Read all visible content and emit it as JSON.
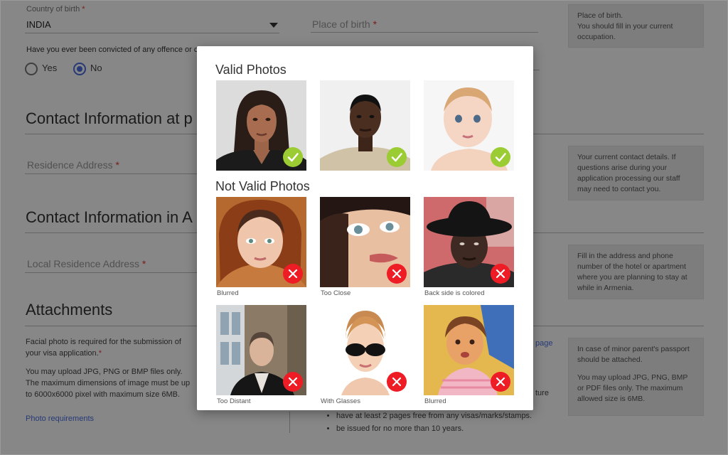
{
  "form": {
    "country_label": "Country of birth",
    "country_value": "INDIA",
    "place_placeholder": "Place of birth",
    "required_mark": "*",
    "convicted_question": "Have you ever been convicted of any offence or crime",
    "yes_label": "Yes",
    "no_label": "No",
    "selected_option": "No",
    "place_hint": [
      "Place of birth.",
      "You should fill in your current",
      "occupation."
    ],
    "contact_heading": "Contact Information at p",
    "residence_placeholder": "Residence Address",
    "contact_hint": "Your current contact details. If questions arise during your application processing our staff may need to contact you.",
    "contact_armenia_heading": "Contact Information in A",
    "local_residence_placeholder": "Local Residence Address",
    "armenia_hint": "Fill in the address and phone number of the hotel or apartment where you are planning to stay at while in Armenia.",
    "attachments_heading": "Attachments",
    "facial_photo_text": "Facial photo is required for the submission of your visa application.",
    "upload_text": "You may upload JPG, PNG or BMP files only. The maximum dimensions of image must be up to 6000x6000 pixel with maximum size 6MB.",
    "photo_requirements_link": "Photo requirements",
    "page_fragment": "page",
    "ture_fragment": "ture",
    "passport_bullets": [
      "have at least 2 pages free from any visas/marks/stamps.",
      "be issued for no more than 10 years."
    ],
    "passport_hint_1": "In case of minor parent's passport should be attached.",
    "passport_hint_2": "You may upload JPG, PNG, BMP or PDF files only. The maximum allowed size is 6MB."
  },
  "modal": {
    "valid_heading": "Valid Photos",
    "not_valid_heading": "Not Valid Photos",
    "valid_photos": [
      {
        "subject": "woman-portrait",
        "status": "valid",
        "badge_icon": "check-icon"
      },
      {
        "subject": "man-portrait",
        "status": "valid",
        "badge_icon": "check-icon"
      },
      {
        "subject": "baby-portrait",
        "status": "valid",
        "badge_icon": "check-icon"
      }
    ],
    "invalid_photos": [
      {
        "caption": "Blurred",
        "subject": "woman-headscarf",
        "badge_icon": "cross-icon"
      },
      {
        "caption": "Too Close",
        "subject": "woman-closeup",
        "badge_icon": "cross-icon"
      },
      {
        "caption": "Back side is colored",
        "subject": "man-hat",
        "badge_icon": "cross-icon"
      },
      {
        "caption": "Too Distant",
        "subject": "man-street",
        "badge_icon": "cross-icon"
      },
      {
        "caption": "With Glasses",
        "subject": "woman-sunglasses",
        "badge_icon": "cross-icon"
      },
      {
        "caption": "Blurred",
        "subject": "child-blurred",
        "badge_icon": "cross-icon"
      }
    ]
  },
  "colors": {
    "accent_blue": "#4a6ee0",
    "valid_green": "#9ccc33",
    "invalid_red": "#ee1c25",
    "overlay": "rgba(0,0,0,0.47)"
  }
}
